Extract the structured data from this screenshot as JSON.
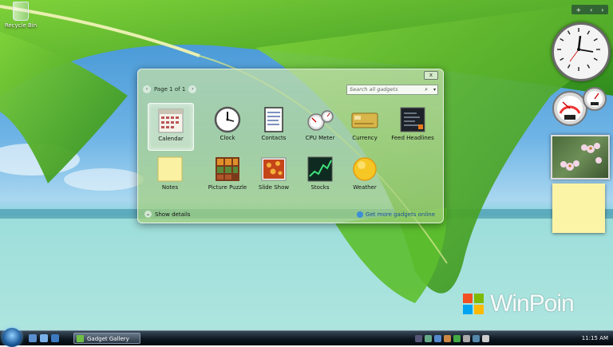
{
  "desktop": {
    "recycle_bin_label": "Recycle Bin",
    "watermark_text": "WinPoin"
  },
  "sidebar": {
    "controls": [
      "+",
      "‹",
      "›"
    ],
    "gadgets": [
      "clock",
      "cpu-meter",
      "slide-show",
      "notes"
    ]
  },
  "gallery": {
    "close_label": "x",
    "pager": {
      "prev": "‹",
      "next": "›",
      "text": "Page 1 of 1"
    },
    "search": {
      "placeholder": "Search all gadgets"
    },
    "items": [
      {
        "label": "Calendar",
        "icon": "calendar-icon",
        "selected": true
      },
      {
        "label": "Clock",
        "icon": "clock-icon"
      },
      {
        "label": "Contacts",
        "icon": "contacts-icon"
      },
      {
        "label": "CPU Meter",
        "icon": "cpu-meter-icon"
      },
      {
        "label": "Currency",
        "icon": "currency-icon"
      },
      {
        "label": "Feed Headlines",
        "icon": "feed-headlines-icon"
      },
      {
        "label": "Notes",
        "icon": "notes-icon"
      },
      {
        "label": "Picture Puzzle",
        "icon": "picture-puzzle-icon"
      },
      {
        "label": "Slide Show",
        "icon": "slide-show-icon"
      },
      {
        "label": "Stocks",
        "icon": "stocks-icon"
      },
      {
        "label": "Weather",
        "icon": "weather-icon"
      }
    ],
    "show_details": "Show details",
    "get_more": "Get more gadgets online"
  },
  "taskbar": {
    "active_task": "Gadget Gallery",
    "clock": "11:15 AM"
  },
  "colors": {
    "selection": "#ffffff",
    "link": "#1a4f9a",
    "notes_yellow": "#fbf4a6"
  }
}
